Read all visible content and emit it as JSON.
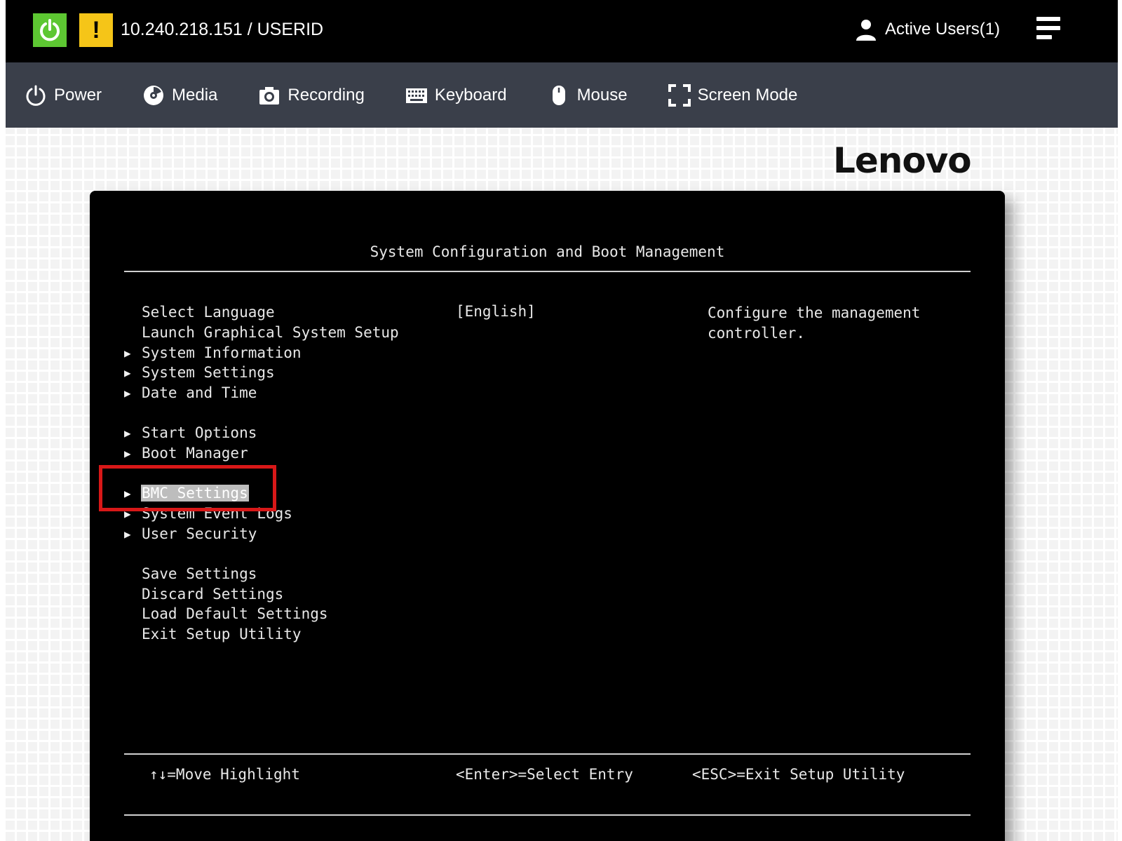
{
  "header": {
    "host": "10.240.218.151 / USERID",
    "warning_glyph": "!",
    "active_users": "Active Users(1)",
    "power_status_color": "#5dc732",
    "warning_color": "#f5c518"
  },
  "toolbar": {
    "power": "Power",
    "media": "Media",
    "recording": "Recording",
    "keyboard": "Keyboard",
    "mouse": "Mouse",
    "screen_mode": "Screen Mode"
  },
  "brand": {
    "logo": "Lenovo"
  },
  "bios": {
    "title": "System Configuration and Boot Management",
    "menu": [
      {
        "label": "Select Language",
        "submenu": false
      },
      {
        "label": "Launch Graphical System Setup",
        "submenu": false
      },
      {
        "label": "System Information",
        "submenu": true
      },
      {
        "label": "System Settings",
        "submenu": true
      },
      {
        "label": "Date and Time",
        "submenu": true
      },
      {
        "label": "Start Options",
        "submenu": true
      },
      {
        "label": "Boot Manager",
        "submenu": true
      },
      {
        "label": "BMC Settings",
        "submenu": true,
        "selected": true
      },
      {
        "label": "System Event Logs",
        "submenu": true
      },
      {
        "label": "User Security",
        "submenu": true
      },
      {
        "label": "Save Settings",
        "submenu": false
      },
      {
        "label": "Discard Settings",
        "submenu": false
      },
      {
        "label": "Load Default Settings",
        "submenu": false
      },
      {
        "label": "Exit Setup Utility",
        "submenu": false
      }
    ],
    "language_value": "[English]",
    "help_text": "Configure the management controller.",
    "footer": {
      "move": "↑↓=Move Highlight",
      "enter": "<Enter>=Select Entry",
      "esc": "<ESC>=Exit Setup Utility"
    }
  },
  "annotation": {
    "highlight_color": "#d81818"
  }
}
